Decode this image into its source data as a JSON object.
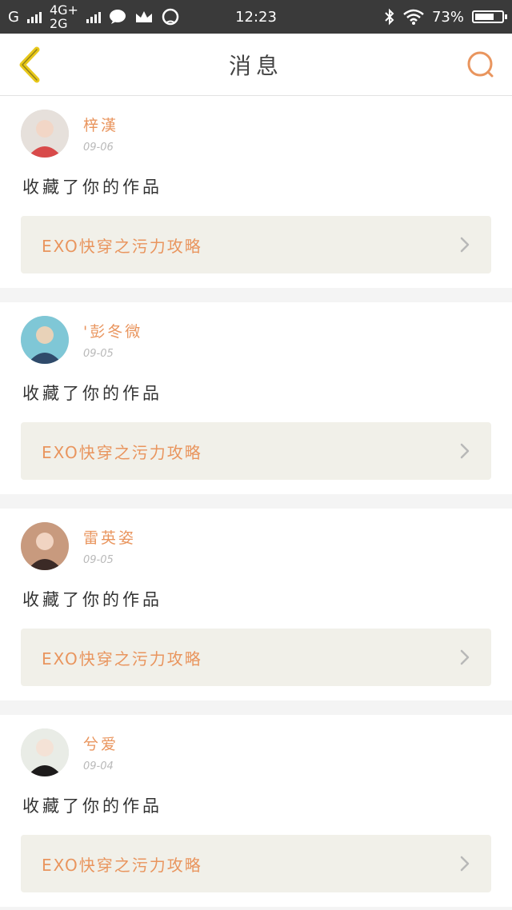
{
  "status_bar": {
    "carrier": "G",
    "network_top": "4G+",
    "network_bottom": "2G",
    "time": "12:23",
    "battery": "73%",
    "battery_level": 0.73,
    "icons": [
      "signal-icon",
      "chat-icon",
      "crown-icon",
      "qq-icon",
      "bluetooth-icon",
      "wifi-icon",
      "battery-icon"
    ]
  },
  "header": {
    "title": "消息",
    "back_icon": "back-chevron-icon",
    "search_icon": "search-icon"
  },
  "colors": {
    "accent": "#e9955e",
    "back_icon": "#e8c81a",
    "card_work_bg": "#f1f0e9",
    "status_bar_bg": "#3a3a3a"
  },
  "messages": [
    {
      "user": "梓漢",
      "date": "09-06",
      "action": "收藏了你的作品",
      "work_title": "EXO快穿之污力攻略"
    },
    {
      "user": "'彭冬微",
      "date": "09-05",
      "action": "收藏了你的作品",
      "work_title": "EXO快穿之污力攻略"
    },
    {
      "user": "雷英姿",
      "date": "09-05",
      "action": "收藏了你的作品",
      "work_title": "EXO快穿之污力攻略"
    },
    {
      "user": "兮爱",
      "date": "09-04",
      "action": "收藏了你的作品",
      "work_title": "EXO快穿之污力攻略"
    }
  ]
}
